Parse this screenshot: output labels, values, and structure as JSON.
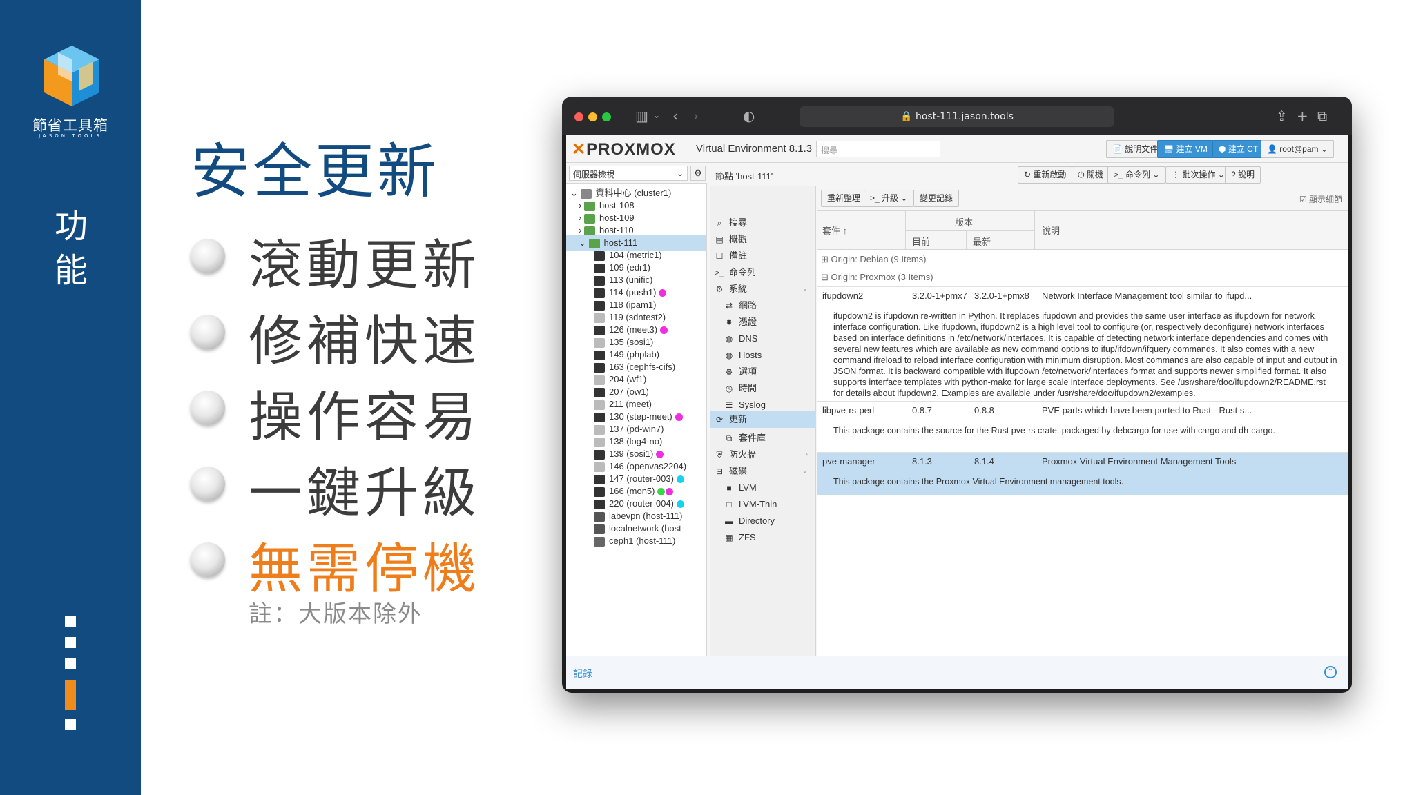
{
  "brand": {
    "logo_name": "節省工具箱",
    "logo_sub": "JASON TOOLS",
    "rail_title": "功能"
  },
  "slide": {
    "title": "安全更新",
    "bullets": [
      "滾動更新",
      "修補快速",
      "操作容易",
      "一鍵升級",
      "無需停機"
    ],
    "note": "註：大版本除外",
    "colors": {
      "primary": "#124b80",
      "accent": "#ee7d1a"
    }
  },
  "browser": {
    "url": "host-111.jason.tools"
  },
  "proxmox": {
    "logo": "PROXMOX",
    "version": "Virtual Environment 8.1.3",
    "search_placeholder": "搜尋",
    "top_buttons": [
      "說明文件",
      "建立 VM",
      "建立 CT",
      "root@pam"
    ],
    "view_select": "伺服器檢視",
    "tree": [
      "資料中心 (cluster1)",
      "host-108",
      "host-109",
      "host-110",
      "host-111",
      "104 (metric1)",
      "109 (edr1)",
      "113 (unific)",
      "114 (push1)",
      "118 (ipam1)",
      "119 (sdntest2)",
      "126 (meet3)",
      "135 (sosi1)",
      "149 (phplab)",
      "163 (cephfs-cifs)",
      "204 (wf1)",
      "207 (ow1)",
      "211 (meet)",
      "130 (step-meet)",
      "137 (pd-win7)",
      "138 (log4-no)",
      "139 (sosi1)",
      "146 (openvas2204)",
      "147 (router-003)",
      "166 (mon5)",
      "220 (router-004)",
      "labevpn (host-111)",
      "localnetwork (host-",
      "ceph1 (host-111)"
    ],
    "crumb": "節點 'host-111'",
    "crumb_buttons": [
      "重新啟動",
      "關機",
      "命令列",
      "批次操作",
      "說明"
    ],
    "menu": [
      "搜尋",
      "概觀",
      "備註",
      "命令列",
      "系統",
      "網路",
      "憑證",
      "DNS",
      "Hosts",
      "選項",
      "時間",
      "Syslog",
      "更新",
      "套件庫",
      "防火牆",
      "磁碟",
      "LVM",
      "LVM-Thin",
      "Directory",
      "ZFS"
    ],
    "content_buttons": [
      "重新整理",
      "升級",
      "變更記錄"
    ],
    "show_details": "顯示細節",
    "columns": {
      "package": "套件 ↑",
      "version": "版本",
      "current": "目前",
      "latest": "最新",
      "desc": "說明"
    },
    "group_debian": "Origin: Debian (9 Items)",
    "group_proxmox": "Origin: Proxmox (3 Items)",
    "packages": [
      {
        "name": "ifupdown2",
        "current": "3.2.0-1+pmx7",
        "latest": "3.2.0-1+pmx8",
        "summary": "Network Interface Management tool similar to ifupd...",
        "detail": "ifupdown2 is ifupdown re-written in Python. It replaces ifupdown and provides the same user interface as ifupdown for network interface configuration. Like ifupdown, ifupdown2 is a high level tool to configure (or, respectively deconfigure) network interfaces based on interface definitions in /etc/network/interfaces. It is capable of detecting network interface dependencies and comes with several new features which are available as new command options to ifup/ifdown/ifquery commands. It also comes with a new command ifreload to reload interface configuration with minimum disruption. Most commands are also capable of input and output in JSON format. It is backward compatible with ifupdown /etc/network/interfaces format and supports newer simplified format. It also supports interface templates with python-mako for large scale interface deployments. See /usr/share/doc/ifupdown2/README.rst for details about ifupdown2. Examples are available under /usr/share/doc/ifupdown2/examples."
      },
      {
        "name": "libpve-rs-perl",
        "current": "0.8.7",
        "latest": "0.8.8",
        "summary": "PVE parts which have been ported to Rust - Rust s...",
        "detail": "This package contains the source for the Rust pve-rs crate, packaged by debcargo for use with cargo and dh-cargo."
      },
      {
        "name": "pve-manager",
        "current": "8.1.3",
        "latest": "8.1.4",
        "summary": "Proxmox Virtual Environment Management Tools",
        "detail": "This package contains the Proxmox Virtual Environment management tools."
      }
    ],
    "log_label": "記錄"
  }
}
